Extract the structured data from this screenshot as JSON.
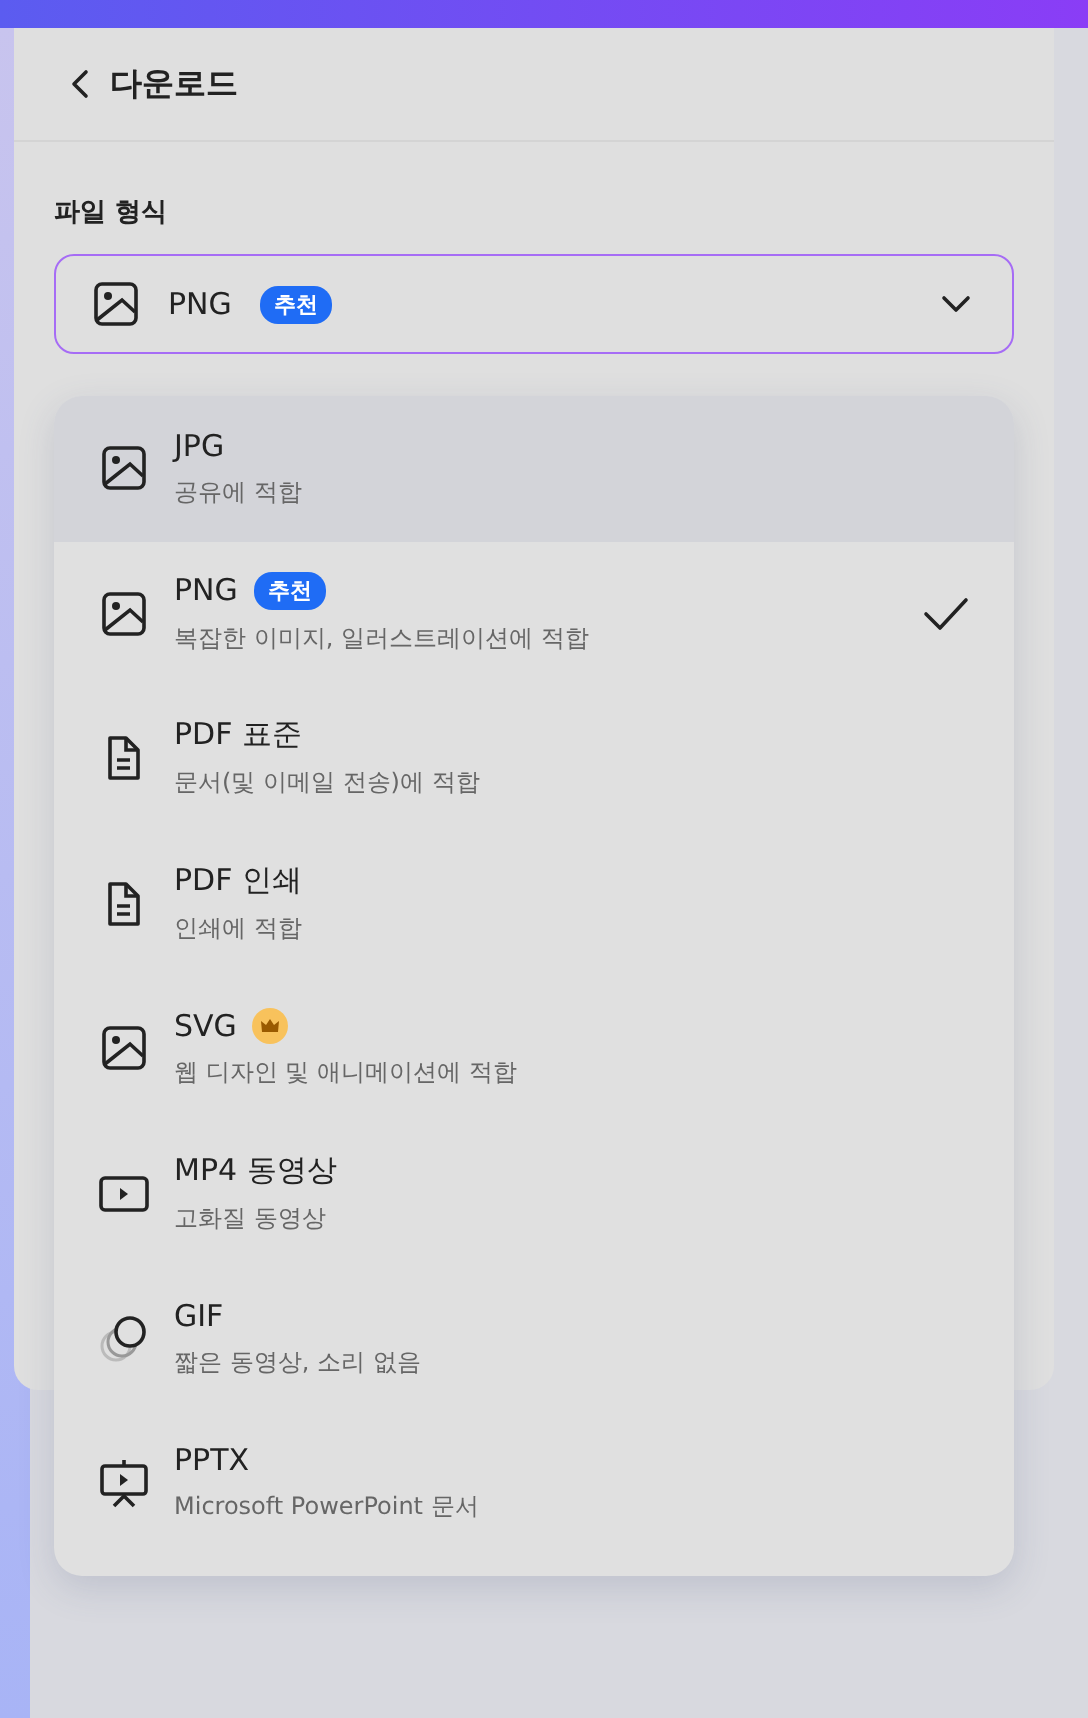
{
  "header": {
    "title": "다운로드"
  },
  "file_format": {
    "label": "파일 형식",
    "value": "PNG",
    "badge": "추천"
  },
  "options": [
    {
      "kind": "image",
      "title": "JPG",
      "subtitle": "공유에 적합",
      "highlighted": true,
      "selected": false
    },
    {
      "kind": "image",
      "title": "PNG",
      "badge": "추천",
      "subtitle": "복잡한 이미지, 일러스트레이션에 적합",
      "highlighted": false,
      "selected": true
    },
    {
      "kind": "document",
      "title": "PDF 표준",
      "subtitle": "문서(및 이메일 전송)에 적합",
      "highlighted": false,
      "selected": false
    },
    {
      "kind": "document",
      "title": "PDF 인쇄",
      "subtitle": "인쇄에 적합",
      "highlighted": false,
      "selected": false
    },
    {
      "kind": "image",
      "title": "SVG",
      "premium": true,
      "subtitle": "웹 디자인 및 애니메이션에 적합",
      "highlighted": false,
      "selected": false
    },
    {
      "kind": "video",
      "title": "MP4 동영상",
      "subtitle": "고화질 동영상",
      "highlighted": false,
      "selected": false
    },
    {
      "kind": "gif",
      "title": "GIF",
      "subtitle": "짧은 동영상, 소리 없음",
      "highlighted": false,
      "selected": false
    },
    {
      "kind": "presentation",
      "title": "PPTX",
      "subtitle": "Microsoft PowerPoint 문서",
      "highlighted": false,
      "selected": false
    }
  ]
}
